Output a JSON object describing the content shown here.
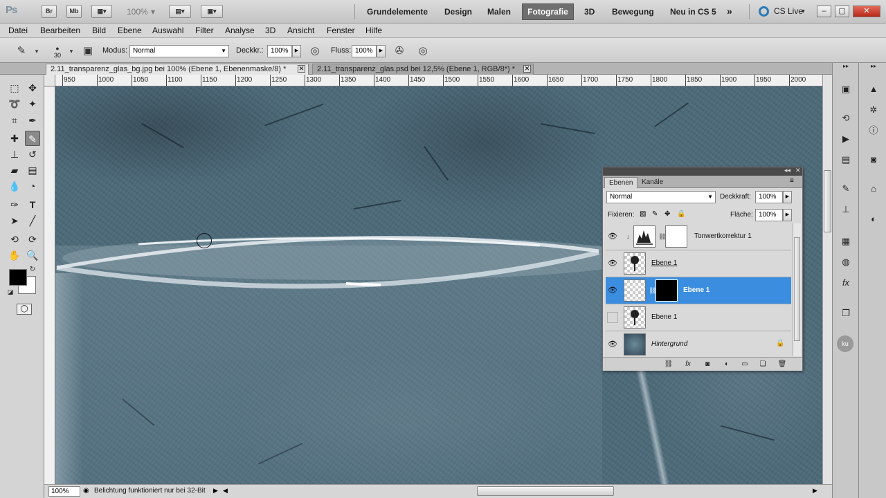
{
  "appbar": {
    "logo": "Ps",
    "bridge_label": "Br",
    "minibridge_label": "Mb",
    "zoom": "100%",
    "workspaces": [
      "Grundelemente",
      "Design",
      "Malen",
      "Fotografie",
      "3D",
      "Bewegung",
      "Neu in CS 5"
    ],
    "active_workspace": "Fotografie",
    "more": "»",
    "cslive": "CS Live"
  },
  "menu": [
    "Datei",
    "Bearbeiten",
    "Bild",
    "Ebene",
    "Auswahl",
    "Filter",
    "Analyse",
    "3D",
    "Ansicht",
    "Fenster",
    "Hilfe"
  ],
  "options": {
    "brush_size": "30",
    "mode_label": "Modus:",
    "mode_value": "Normal",
    "opacity_label": "Deckkr.:",
    "opacity_value": "100%",
    "flow_label": "Fluss:",
    "flow_value": "100%"
  },
  "tabs": [
    {
      "title": "2.11_transparenz_glas_bg.jpg bei 100% (Ebene 1, Ebenenmaske/8) *",
      "active": true
    },
    {
      "title": "2.11_transparenz_glas.psd bei 12,5% (Ebene 1, RGB/8*) *",
      "active": false
    }
  ],
  "ruler": {
    "h_ticks": [
      "950",
      "1000",
      "1050",
      "1100",
      "1150",
      "1200",
      "1250",
      "1300",
      "1350",
      "1400",
      "1450",
      "1500",
      "1550",
      "1600",
      "1650",
      "1700",
      "1750",
      "1800",
      "1850",
      "1900",
      "1950",
      "2000"
    ]
  },
  "status": {
    "zoom": "100%",
    "message": "Belichtung funktioniert nur bei 32-Bit"
  },
  "layers_panel": {
    "tab_layers": "Ebenen",
    "tab_channels": "Kanäle",
    "blend_mode": "Normal",
    "opacity_label": "Deckkraft:",
    "opacity_value": "100%",
    "lock_label": "Fixieren:",
    "fill_label": "Fläche:",
    "fill_value": "100%",
    "layers": [
      {
        "name": "Tonwertkorrektur 1",
        "visible": true,
        "selected": false
      },
      {
        "name": "Ebene 1",
        "visible": true,
        "selected": false
      },
      {
        "name": "Ebene 1",
        "visible": true,
        "selected": true
      },
      {
        "name": "Ebene 1",
        "visible": false,
        "selected": false
      },
      {
        "name": "Hintergrund",
        "visible": true,
        "selected": false
      }
    ]
  },
  "colors": {
    "canvas": "#4e6b7a",
    "selection": "#3b8de0",
    "foreground": "#000000",
    "background": "#ffffff"
  }
}
